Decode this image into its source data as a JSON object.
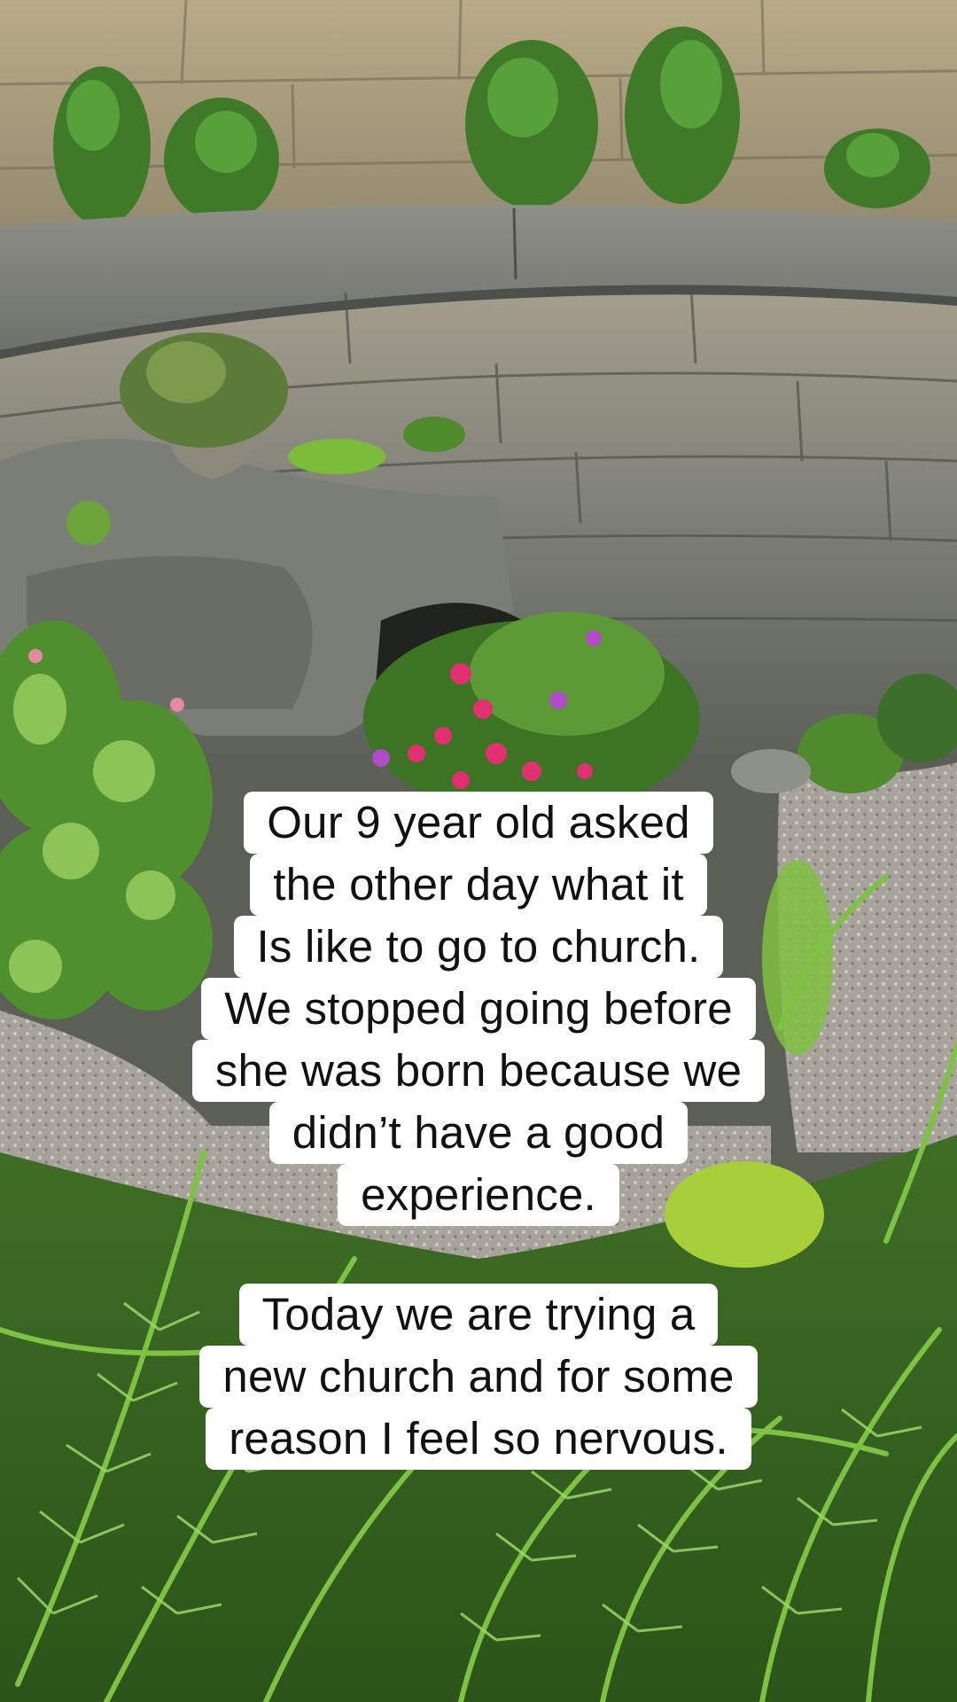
{
  "overlay": {
    "caption_1": [
      "Our 9 year old asked",
      "the other day what it",
      "Is like to go to church.",
      "We stopped going before",
      "she was born because we",
      "didn’t have a good",
      "experience."
    ],
    "caption_2": [
      "Today we are trying a",
      "new church and for some",
      "reason I feel so nervous."
    ]
  },
  "colors": {
    "caption_background": "#ffffff",
    "caption_text": "#111111",
    "stone_wall": "#8a8b80",
    "fern_green": "#5f9e2f",
    "flower_pink": "#e0306f"
  }
}
